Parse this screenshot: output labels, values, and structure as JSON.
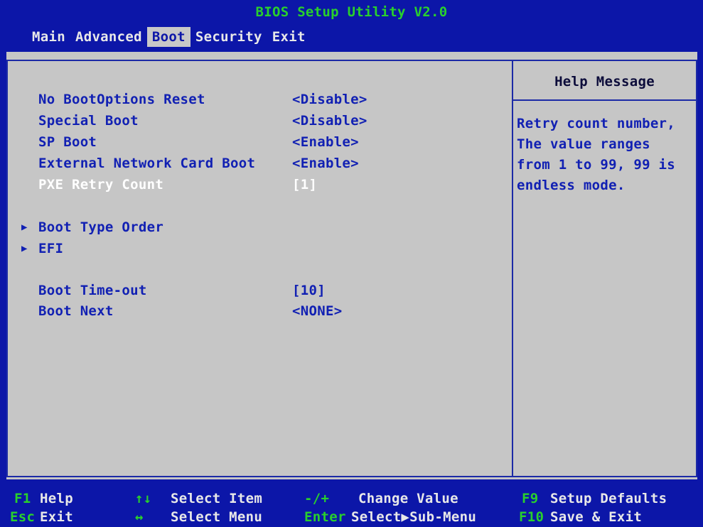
{
  "header": {
    "title": "BIOS Setup Utility V2.0"
  },
  "menu": {
    "tabs": [
      "Main",
      "Advanced",
      "Boot",
      "Security",
      "Exit"
    ],
    "active": "Boot"
  },
  "settings": [
    {
      "label": "No BootOptions Reset",
      "value": "<Disable>"
    },
    {
      "label": "Special Boot",
      "value": "<Disable>"
    },
    {
      "label": "SP Boot",
      "value": "<Enable>"
    },
    {
      "label": "External Network Card Boot",
      "value": "<Enable>"
    },
    {
      "label": "PXE Retry Count",
      "value": "[1]"
    }
  ],
  "submenus": [
    {
      "label": "Boot Type Order",
      "icon": "triangle-right-icon"
    },
    {
      "label": "EFI",
      "icon": "triangle-right-icon"
    }
  ],
  "settings2": [
    {
      "label": "Boot Time-out",
      "value": "[10]"
    },
    {
      "label": "Boot Next",
      "value": "<NONE>"
    }
  ],
  "help": {
    "title": "Help Message",
    "lines": [
      "Retry count number,",
      "The value ranges",
      "from 1 to 99, 99 is",
      "endless mode."
    ]
  },
  "footer": {
    "items": [
      {
        "key": "F1",
        "desc": "Help"
      },
      {
        "key": "Esc",
        "desc": "Exit"
      },
      {
        "key": "↑↓",
        "desc": "Select Item"
      },
      {
        "key": "↔",
        "desc": "Select Menu"
      },
      {
        "key": "-/+",
        "desc": "Change Value"
      },
      {
        "key": "Enter",
        "desc": "Select▶Sub-Menu"
      },
      {
        "key": "F9",
        "desc": "Setup Defaults"
      },
      {
        "key": "F10",
        "desc": "Save & Exit"
      }
    ]
  },
  "colors": {
    "background": "#0c16a8",
    "panel": "#c6c6c6",
    "text": "#1120b3",
    "highlight": "#ffffff",
    "key": "#29d02c"
  }
}
